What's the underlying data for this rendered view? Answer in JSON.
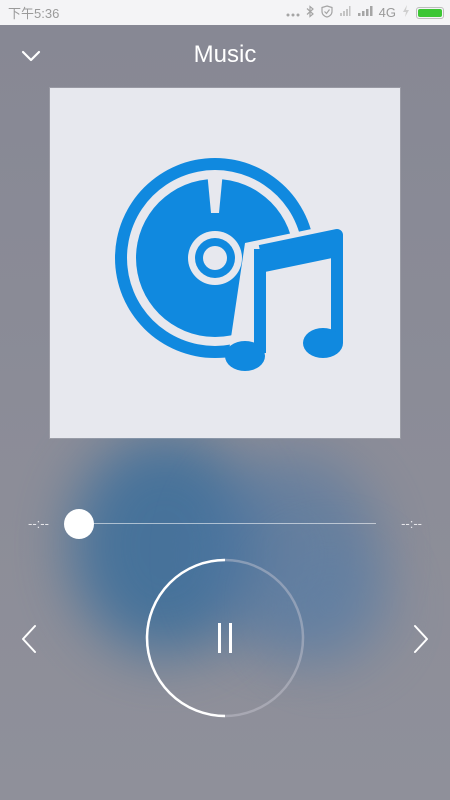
{
  "status_bar": {
    "time": "下午5:36",
    "icons": [
      "more-dots-icon",
      "bluetooth-icon",
      "shield-icon",
      "signal-off-icon",
      "signal-icon",
      "charging-icon"
    ],
    "network": "4G",
    "battery_color": "#3cc634"
  },
  "header": {
    "title": "Music",
    "back_icon": "chevron-down-icon"
  },
  "album_art": {
    "icon": "music-disc-icon",
    "accent_color": "#1089df",
    "background": "#e7e8ee"
  },
  "player": {
    "elapsed": "--:--",
    "duration": "--:--",
    "progress": 0,
    "state": "playing",
    "play_pause_icon": "pause-icon",
    "prev_icon": "chevron-left-icon",
    "next_icon": "chevron-right-icon"
  }
}
